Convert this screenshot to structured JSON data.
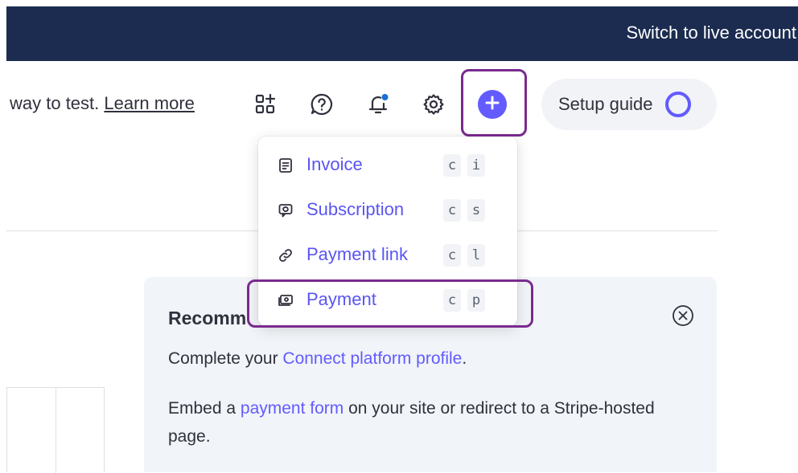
{
  "topbar": {
    "switch_label": "Switch to live account"
  },
  "notice": {
    "text": "way to test. ",
    "link": "Learn more"
  },
  "toolbar": {
    "icons": [
      "add-apps-icon",
      "help-icon",
      "notifications-icon",
      "settings-icon",
      "create-plus-icon"
    ],
    "setup_guide_label": "Setup guide"
  },
  "create_menu": {
    "items": [
      {
        "label": "Invoice",
        "icon": "invoice-icon",
        "key1": "c",
        "key2": "i"
      },
      {
        "label": "Subscription",
        "icon": "subscription-icon",
        "key1": "c",
        "key2": "s"
      },
      {
        "label": "Payment link",
        "icon": "link-icon",
        "key1": "c",
        "key2": "l"
      },
      {
        "label": "Payment",
        "icon": "payment-icon",
        "key1": "c",
        "key2": "p"
      }
    ]
  },
  "card": {
    "title": "Recomm",
    "line1_pre": "Complete your ",
    "line1_link": "Connect platform profile",
    "line1_post": ".",
    "line2_pre": "Embed a ",
    "line2_link": "payment form",
    "line2_post": " on your site or redirect to a Stripe-hosted page."
  },
  "colors": {
    "topbar": "#1b2c50",
    "accent": "#635bff",
    "highlight": "#7a2a8e",
    "notification_dot": "#1a6fd6"
  }
}
